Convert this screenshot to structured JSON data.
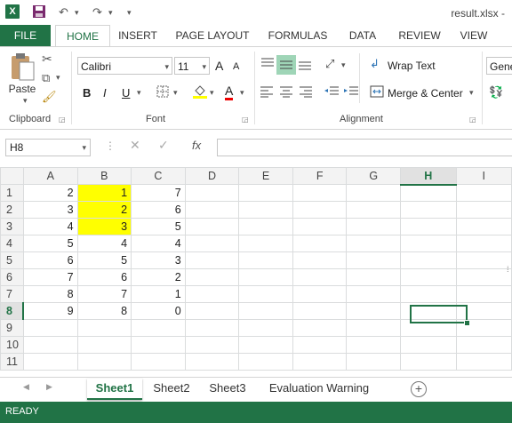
{
  "titlebar": {
    "excel_icon": "excel-icon",
    "save_icon": "save-icon",
    "undo_icon": "undo-icon",
    "redo_icon": "redo-icon",
    "customize_icon": "customize-qat-icon",
    "file_title": "result.xlsx -"
  },
  "ribbon_tabs": {
    "file": "FILE",
    "home": "HOME",
    "insert": "INSERT",
    "page_layout": "PAGE LAYOUT",
    "formulas": "FORMULAS",
    "data": "DATA",
    "review": "REVIEW",
    "view": "VIEW"
  },
  "clipboard": {
    "paste": "Paste",
    "label": "Clipboard"
  },
  "font": {
    "name": "Calibri",
    "size": "11",
    "grow": "A",
    "shrink": "A",
    "bold": "B",
    "italic": "I",
    "underline": "U",
    "font_color": "A",
    "label": "Font"
  },
  "alignment": {
    "wrap_text": "Wrap Text",
    "merge_center": "Merge & Center",
    "label": "Alignment"
  },
  "number": {
    "format": "Gene"
  },
  "formula_bar": {
    "name_box": "H8",
    "fx": "fx",
    "value": ""
  },
  "grid": {
    "columns": [
      "A",
      "B",
      "C",
      "D",
      "E",
      "F",
      "G",
      "H",
      "I"
    ],
    "selected_column": "H",
    "selected_row": "8",
    "rows": [
      {
        "row": "1",
        "A": "2",
        "B": "1",
        "C": "7"
      },
      {
        "row": "2",
        "A": "3",
        "B": "2",
        "C": "6"
      },
      {
        "row": "3",
        "A": "4",
        "B": "3",
        "C": "5"
      },
      {
        "row": "4",
        "A": "5",
        "B": "4",
        "C": "4"
      },
      {
        "row": "5",
        "A": "6",
        "B": "5",
        "C": "3"
      },
      {
        "row": "6",
        "A": "7",
        "B": "6",
        "C": "2"
      },
      {
        "row": "7",
        "A": "8",
        "B": "7",
        "C": "1"
      },
      {
        "row": "8",
        "A": "9",
        "B": "8",
        "C": "0"
      },
      {
        "row": "9"
      },
      {
        "row": "10"
      },
      {
        "row": "11"
      }
    ],
    "highlight_color": "#ffff00"
  },
  "sheets": {
    "tabs": [
      "Sheet1",
      "Sheet2",
      "Sheet3",
      "Evaluation Warning"
    ],
    "active": "Sheet1",
    "add": "+"
  },
  "status": {
    "mode": "READY"
  },
  "colors": {
    "accent": "#217346"
  }
}
